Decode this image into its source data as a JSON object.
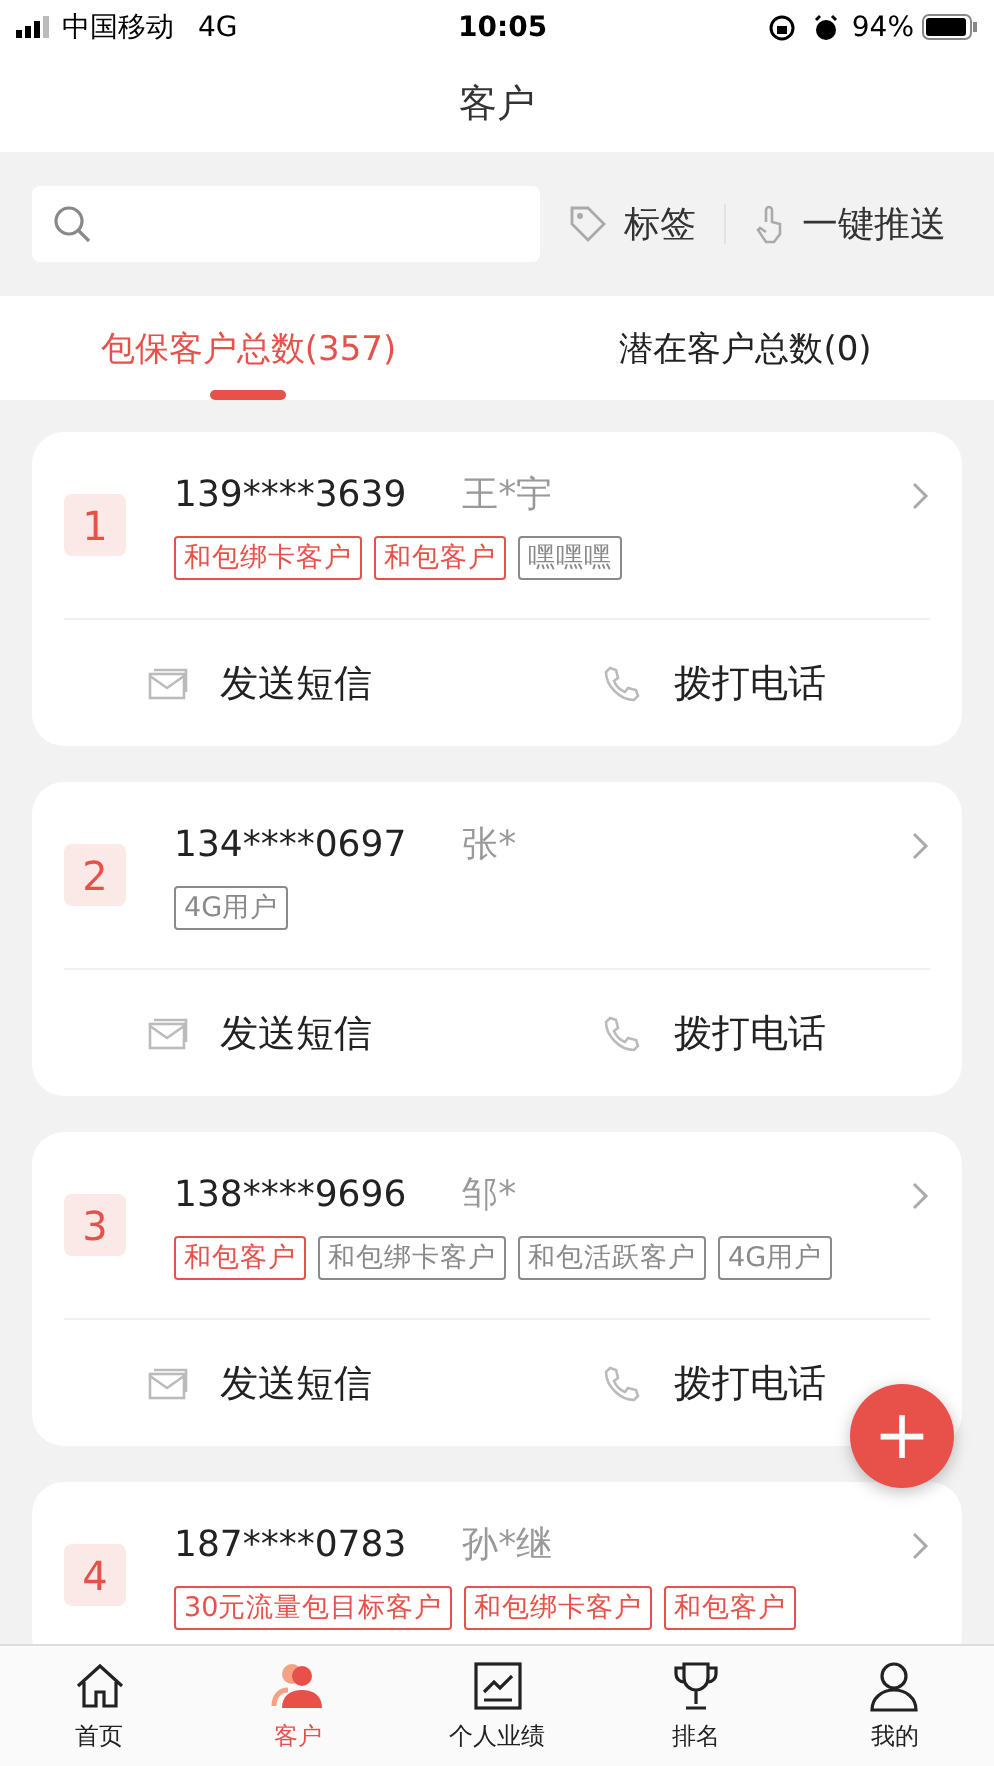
{
  "status_bar": {
    "carrier": "中国移动",
    "network": "4G",
    "time": "10:05",
    "battery": "94%"
  },
  "header": {
    "title": "客户"
  },
  "toolbar": {
    "tag_button": "标签",
    "push_button": "一键推送"
  },
  "tabs": [
    {
      "label": "包保客户总数(357)",
      "selected": true
    },
    {
      "label": "潜在客户总数(0)",
      "selected": false
    }
  ],
  "customers": [
    {
      "index": "1",
      "phone": "139****3639",
      "name": "王*宇",
      "tags": [
        {
          "label": "和包绑卡客户",
          "color": "#e8514a"
        },
        {
          "label": "和包客户",
          "color": "#e8514a"
        },
        {
          "label": "嘿嘿嘿",
          "color": "#8a8a8a"
        }
      ],
      "actions": [
        "发送短信",
        "拨打电话"
      ]
    },
    {
      "index": "2",
      "phone": "134****0697",
      "name": "张*",
      "tags": [
        {
          "label": "4G用户",
          "color": "#8a8a8a"
        }
      ],
      "actions": [
        "发送短信",
        "拨打电话"
      ]
    },
    {
      "index": "3",
      "phone": "138****9696",
      "name": "邹*",
      "tags": [
        {
          "label": "和包客户",
          "color": "#e8514a"
        },
        {
          "label": "和包绑卡客户",
          "color": "#8a8a8a"
        },
        {
          "label": "和包活跃客户",
          "color": "#8a8a8a"
        },
        {
          "label": "4G用户",
          "color": "#8a8a8a"
        }
      ],
      "actions": [
        "发送短信",
        "拨打电话"
      ]
    },
    {
      "index": "4",
      "phone": "187****0783",
      "name": "孙*继",
      "tags": [
        {
          "label": "30元流量包目标客户",
          "color": "#e8514a"
        },
        {
          "label": "和包绑卡客户",
          "color": "#e8514a"
        },
        {
          "label": "和包客户",
          "color": "#e8514a"
        }
      ]
    }
  ],
  "fab": {
    "label": "+"
  },
  "nav": [
    {
      "kind": "home",
      "label": "首页",
      "selected": false
    },
    {
      "kind": "customer",
      "label": "客户",
      "selected": true
    },
    {
      "kind": "chart",
      "label": "个人业绩",
      "selected": false
    },
    {
      "kind": "trophy",
      "label": "排名",
      "selected": false
    },
    {
      "kind": "user",
      "label": "我的",
      "selected": false
    }
  ]
}
